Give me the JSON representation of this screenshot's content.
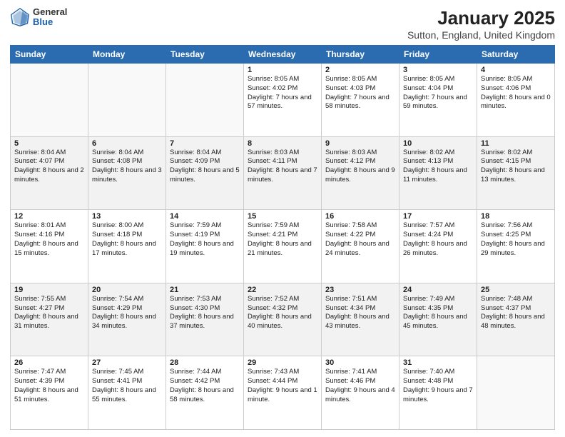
{
  "header": {
    "logo_general": "General",
    "logo_blue": "Blue",
    "title": "January 2025",
    "subtitle": "Sutton, England, United Kingdom"
  },
  "days_of_week": [
    "Sunday",
    "Monday",
    "Tuesday",
    "Wednesday",
    "Thursday",
    "Friday",
    "Saturday"
  ],
  "weeks": [
    [
      {
        "day": "",
        "info": ""
      },
      {
        "day": "",
        "info": ""
      },
      {
        "day": "",
        "info": ""
      },
      {
        "day": "1",
        "info": "Sunrise: 8:05 AM\nSunset: 4:02 PM\nDaylight: 7 hours and 57 minutes."
      },
      {
        "day": "2",
        "info": "Sunrise: 8:05 AM\nSunset: 4:03 PM\nDaylight: 7 hours and 58 minutes."
      },
      {
        "day": "3",
        "info": "Sunrise: 8:05 AM\nSunset: 4:04 PM\nDaylight: 7 hours and 59 minutes."
      },
      {
        "day": "4",
        "info": "Sunrise: 8:05 AM\nSunset: 4:06 PM\nDaylight: 8 hours and 0 minutes."
      }
    ],
    [
      {
        "day": "5",
        "info": "Sunrise: 8:04 AM\nSunset: 4:07 PM\nDaylight: 8 hours and 2 minutes."
      },
      {
        "day": "6",
        "info": "Sunrise: 8:04 AM\nSunset: 4:08 PM\nDaylight: 8 hours and 3 minutes."
      },
      {
        "day": "7",
        "info": "Sunrise: 8:04 AM\nSunset: 4:09 PM\nDaylight: 8 hours and 5 minutes."
      },
      {
        "day": "8",
        "info": "Sunrise: 8:03 AM\nSunset: 4:11 PM\nDaylight: 8 hours and 7 minutes."
      },
      {
        "day": "9",
        "info": "Sunrise: 8:03 AM\nSunset: 4:12 PM\nDaylight: 8 hours and 9 minutes."
      },
      {
        "day": "10",
        "info": "Sunrise: 8:02 AM\nSunset: 4:13 PM\nDaylight: 8 hours and 11 minutes."
      },
      {
        "day": "11",
        "info": "Sunrise: 8:02 AM\nSunset: 4:15 PM\nDaylight: 8 hours and 13 minutes."
      }
    ],
    [
      {
        "day": "12",
        "info": "Sunrise: 8:01 AM\nSunset: 4:16 PM\nDaylight: 8 hours and 15 minutes."
      },
      {
        "day": "13",
        "info": "Sunrise: 8:00 AM\nSunset: 4:18 PM\nDaylight: 8 hours and 17 minutes."
      },
      {
        "day": "14",
        "info": "Sunrise: 7:59 AM\nSunset: 4:19 PM\nDaylight: 8 hours and 19 minutes."
      },
      {
        "day": "15",
        "info": "Sunrise: 7:59 AM\nSunset: 4:21 PM\nDaylight: 8 hours and 21 minutes."
      },
      {
        "day": "16",
        "info": "Sunrise: 7:58 AM\nSunset: 4:22 PM\nDaylight: 8 hours and 24 minutes."
      },
      {
        "day": "17",
        "info": "Sunrise: 7:57 AM\nSunset: 4:24 PM\nDaylight: 8 hours and 26 minutes."
      },
      {
        "day": "18",
        "info": "Sunrise: 7:56 AM\nSunset: 4:25 PM\nDaylight: 8 hours and 29 minutes."
      }
    ],
    [
      {
        "day": "19",
        "info": "Sunrise: 7:55 AM\nSunset: 4:27 PM\nDaylight: 8 hours and 31 minutes."
      },
      {
        "day": "20",
        "info": "Sunrise: 7:54 AM\nSunset: 4:29 PM\nDaylight: 8 hours and 34 minutes."
      },
      {
        "day": "21",
        "info": "Sunrise: 7:53 AM\nSunset: 4:30 PM\nDaylight: 8 hours and 37 minutes."
      },
      {
        "day": "22",
        "info": "Sunrise: 7:52 AM\nSunset: 4:32 PM\nDaylight: 8 hours and 40 minutes."
      },
      {
        "day": "23",
        "info": "Sunrise: 7:51 AM\nSunset: 4:34 PM\nDaylight: 8 hours and 43 minutes."
      },
      {
        "day": "24",
        "info": "Sunrise: 7:49 AM\nSunset: 4:35 PM\nDaylight: 8 hours and 45 minutes."
      },
      {
        "day": "25",
        "info": "Sunrise: 7:48 AM\nSunset: 4:37 PM\nDaylight: 8 hours and 48 minutes."
      }
    ],
    [
      {
        "day": "26",
        "info": "Sunrise: 7:47 AM\nSunset: 4:39 PM\nDaylight: 8 hours and 51 minutes."
      },
      {
        "day": "27",
        "info": "Sunrise: 7:45 AM\nSunset: 4:41 PM\nDaylight: 8 hours and 55 minutes."
      },
      {
        "day": "28",
        "info": "Sunrise: 7:44 AM\nSunset: 4:42 PM\nDaylight: 8 hours and 58 minutes."
      },
      {
        "day": "29",
        "info": "Sunrise: 7:43 AM\nSunset: 4:44 PM\nDaylight: 9 hours and 1 minute."
      },
      {
        "day": "30",
        "info": "Sunrise: 7:41 AM\nSunset: 4:46 PM\nDaylight: 9 hours and 4 minutes."
      },
      {
        "day": "31",
        "info": "Sunrise: 7:40 AM\nSunset: 4:48 PM\nDaylight: 9 hours and 7 minutes."
      },
      {
        "day": "",
        "info": ""
      }
    ]
  ]
}
